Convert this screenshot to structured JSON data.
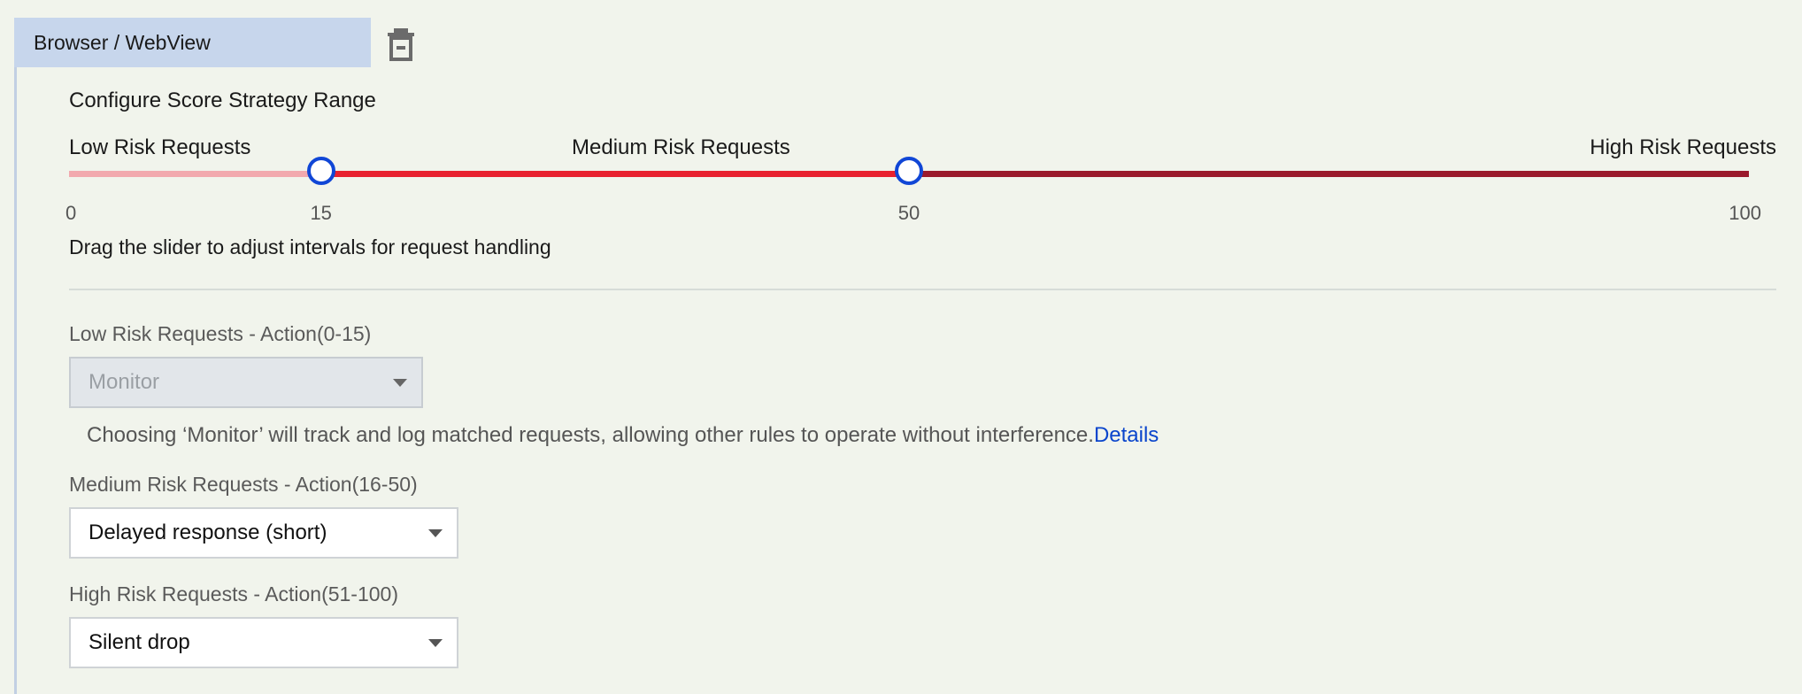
{
  "group": {
    "tab_label": "Browser / WebView"
  },
  "score_range": {
    "title": "Configure Score Strategy Range",
    "low_label": "Low Risk Requests",
    "medium_label": "Medium Risk Requests",
    "high_label": "High Risk Requests",
    "min": 0,
    "max": 100,
    "thresholds": [
      15,
      50
    ],
    "ticks": [
      "0",
      "15",
      "50",
      "100"
    ],
    "hint": "Drag the slider to adjust intervals for request handling",
    "colors": {
      "low": "#f2a9ae",
      "medium": "#e8212f",
      "high": "#9a1a2c",
      "thumb_border": "#1046d6"
    }
  },
  "actions": {
    "low": {
      "label": "Low Risk Requests - Action(0-15)",
      "value": "Monitor",
      "disabled": true,
      "help_text": "Choosing ‘Monitor’ will track and log matched requests, allowing other rules to operate without interference.",
      "help_link": "Details"
    },
    "medium": {
      "label": "Medium Risk Requests - Action(16-50)",
      "value": "Delayed response (short)"
    },
    "high": {
      "label": "High Risk Requests - Action(51-100)",
      "value": "Silent drop"
    }
  },
  "icons": {
    "delete": "trash-icon",
    "dropdown": "chevron-down-icon"
  }
}
